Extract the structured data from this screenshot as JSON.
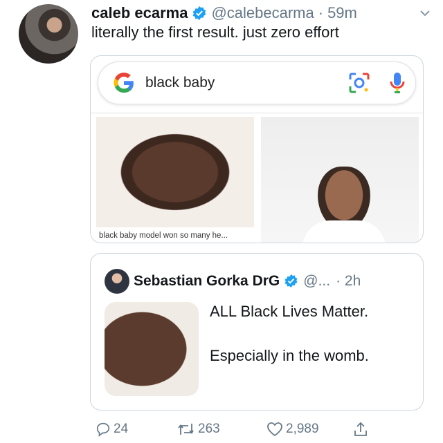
{
  "tweet": {
    "author_name": "caleb ecarma",
    "handle": "@calebecarma",
    "separator": "·",
    "time": "59m",
    "text": "literally the first result. just zero effort"
  },
  "search_card": {
    "query": "black baby",
    "image_caption": "black baby model won so many he..."
  },
  "quoted_tweet": {
    "author_name": "Sebastian Gorka DrG",
    "handle": "@...",
    "time": "· 2h",
    "text": "ALL Black Lives Matter.\n\nEspecially in the womb."
  },
  "actions": {
    "reply_count": "24",
    "retweet_count": "263",
    "like_count": "2,989"
  },
  "colors": {
    "verified_blue": "#1da1f2",
    "secondary_text": "#657786",
    "border": "#ccd6dd"
  }
}
